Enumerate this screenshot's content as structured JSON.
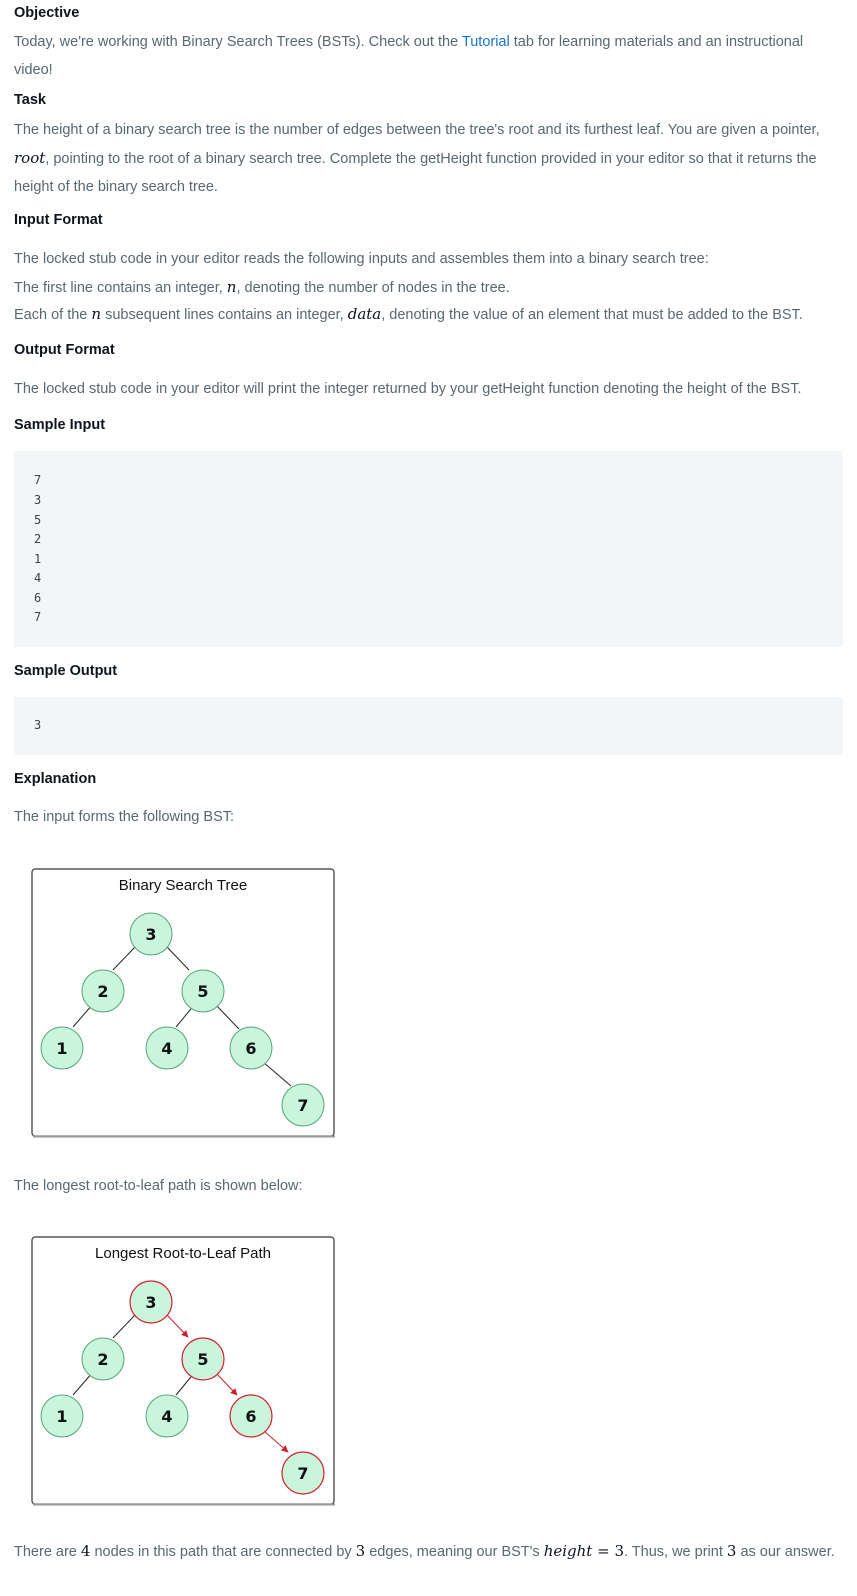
{
  "objective": {
    "heading": "Objective",
    "text_before": "Today, we're working with Binary Search Trees (BSTs). Check out the ",
    "link": "Tutorial",
    "text_after": " tab for learning materials and an instructional video!"
  },
  "task": {
    "heading": "Task",
    "text_1": "The height of a binary search tree is the number of edges between the tree's root and its furthest leaf. You are given a pointer, ",
    "var_root": "root",
    "text_2": ", pointing to the root of a binary search tree. Complete the getHeight function provided in your editor so that it returns the height of the binary search tree."
  },
  "input_format": {
    "heading": "Input Format",
    "line1": "The locked stub code in your editor reads the following inputs and assembles them into a binary search tree:",
    "line2_a": "The first line contains an integer, ",
    "var_n": "n",
    "line2_b": ", denoting the number of nodes in the tree.",
    "line3_a": "Each of the ",
    "line3_b": " subsequent lines contains an integer, ",
    "var_data": "data",
    "line3_c": ", denoting the value of an element that must be added to the BST."
  },
  "output_format": {
    "heading": "Output Format",
    "text": "The locked stub code in your editor will print the integer returned by your getHeight function denoting the height of the BST."
  },
  "sample_input": {
    "heading": "Sample Input",
    "lines": [
      "7",
      "3",
      "5",
      "2",
      "1",
      "4",
      "6",
      "7"
    ]
  },
  "sample_output": {
    "heading": "Sample Output",
    "lines": [
      "3"
    ]
  },
  "explanation": {
    "heading": "Explanation",
    "intro": "The input forms the following BST:",
    "path_intro": "The longest root-to-leaf path is shown below:",
    "conclusion_a": "There are ",
    "num_4": "4",
    "conclusion_b": " nodes in this path that are connected by ",
    "num_3": "3",
    "conclusion_c": " edges, meaning our BST's ",
    "var_height": "height",
    "eq": " = 3",
    "conclusion_d": ". Thus, we print ",
    "conclusion_e": " as our answer."
  },
  "figure1": {
    "title": "Binary Search Tree",
    "nodes": [
      "3",
      "2",
      "5",
      "1",
      "4",
      "6",
      "7"
    ]
  },
  "figure2": {
    "title": "Longest Root-to-Leaf Path",
    "nodes": [
      "3",
      "2",
      "5",
      "1",
      "4",
      "6",
      "7"
    ]
  },
  "colors": {
    "node_fill": "#c9f5dd",
    "node_stroke": "#56a576",
    "path_stroke": "#d0202a",
    "heading": "#0e141e",
    "body": "#576871",
    "link": "#1a73c8",
    "code_bg": "#f3f6f7"
  }
}
